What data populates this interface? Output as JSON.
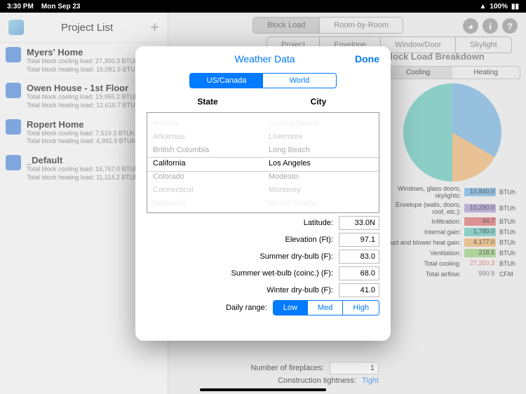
{
  "status": {
    "time": "3:30 PM",
    "date": "Mon Sep 23",
    "battery": "100%"
  },
  "sidebar": {
    "title": "Project List",
    "projects": [
      {
        "name": "Myers' Home",
        "cooling": "Total block cooling load: 27,350.3 BTUh",
        "heating": "Total block heating load: 16,081.9 BTUh"
      },
      {
        "name": "Owen House - 1st Floor",
        "cooling": "Total block cooling load: 19,955.2 BTUh",
        "heating": "Total block heating load: 12,610.7 BTUh"
      },
      {
        "name": "Ropert Home",
        "cooling": "Total block cooling load: 7,519.3 BTUh",
        "heating": "Total block heating load: 4,992.9 BTUh"
      },
      {
        "name": "_Default",
        "cooling": "Total block cooling load: 16,767.0 BTUh",
        "heating": "Total block heating load: 11,114.2 BTUh"
      }
    ]
  },
  "topTabs": {
    "blockLoad": "Block Load",
    "roomByRoom": "Room-by-Room",
    "project": "Project",
    "envelope": "Envelope",
    "windowDoor": "Window/Door",
    "skylight": "Skylight"
  },
  "breakdown": {
    "title": "Block Load Breakdown",
    "cooling": "Cooling",
    "heating": "Heating",
    "rows": [
      {
        "label": "Windows, glass doors, skylights:",
        "val": "10,840.0",
        "unit": "BTUh",
        "color": "#5fa5d8"
      },
      {
        "label": "Envelope (walls, doors, roof, etc.):",
        "val": "10,290.0",
        "unit": "BTUh",
        "color": "#9b88c9"
      },
      {
        "label": "Infiltration:",
        "val": "44.7",
        "unit": "BTUh",
        "color": "#d65a5a"
      },
      {
        "label": "Internal gain:",
        "val": "1,780.0",
        "unit": "BTUh",
        "color": "#4fbdb0"
      },
      {
        "label": "Duct and blower heat gain:",
        "val": "4,177.0",
        "unit": "BTUh",
        "color": "#e8a85c"
      },
      {
        "label": "Ventilation:",
        "val": "218.5",
        "unit": "BTUh",
        "color": "#8cc66b"
      },
      {
        "label": "Total cooling:",
        "val": "27,350.3",
        "unit": "BTUh",
        "color": ""
      },
      {
        "label": "Total airflow:",
        "val": "990.9",
        "unit": "CFM",
        "color": ""
      }
    ]
  },
  "bottomFields": {
    "fireplaces": {
      "label": "Number of fireplaces:",
      "val": "1"
    },
    "tightness": {
      "label": "Construction tightness:",
      "val": "Tight"
    }
  },
  "modal": {
    "title": "Weather Data",
    "done": "Done",
    "region": {
      "usCanada": "US/Canada",
      "world": "World"
    },
    "stateHdr": "State",
    "cityHdr": "City",
    "states": [
      "Arizona",
      "Arkansas",
      "British Columbia",
      "California",
      "Colorado",
      "Connecticut",
      "Delaware"
    ],
    "cities": [
      "Laguna Beach",
      "Livermore",
      "Long Beach",
      "Los Angeles",
      "Modesto",
      "Monterey",
      "Mount Shasta"
    ],
    "fields": {
      "latitude": {
        "label": "Latitude:",
        "val": "33.0N"
      },
      "elevation": {
        "label": "Elevation (Ft):",
        "val": "97.1"
      },
      "summerDry": {
        "label": "Summer dry-bulb (F):",
        "val": "83.0"
      },
      "summerWet": {
        "label": "Summer wet-bulb (coinc.) (F):",
        "val": "68.0"
      },
      "winterDry": {
        "label": "Winter dry-bulb (F):",
        "val": "41.0"
      },
      "dailyRange": {
        "label": "Daily range:",
        "low": "Low",
        "med": "Med",
        "high": "High"
      }
    }
  }
}
